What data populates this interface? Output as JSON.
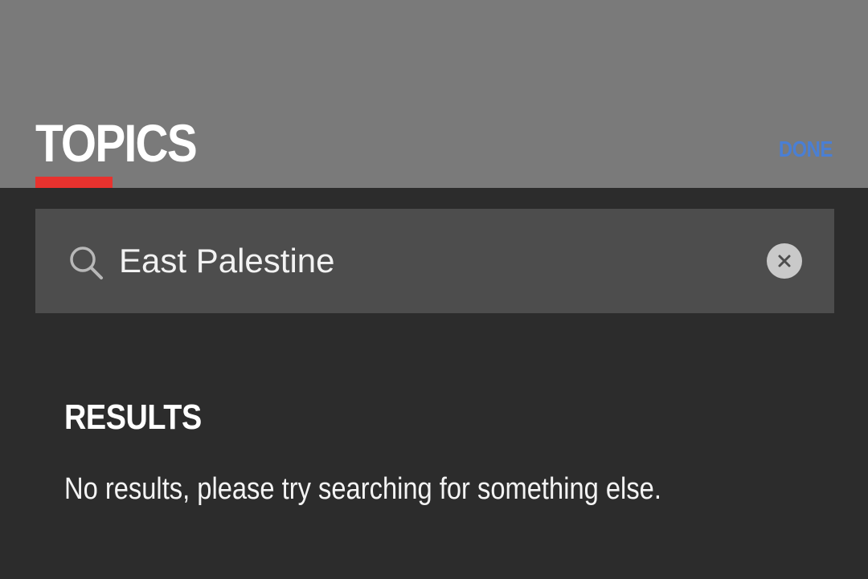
{
  "header": {
    "title": "TOPICS",
    "done_label": "DONE",
    "accent_color": "#e8322e",
    "link_color": "#4a7fd4"
  },
  "search": {
    "value": "East Palestine",
    "icon": "search-icon",
    "clear_icon": "clear-icon"
  },
  "results": {
    "heading": "RESULTS",
    "message": "No results, please try searching for something else."
  }
}
